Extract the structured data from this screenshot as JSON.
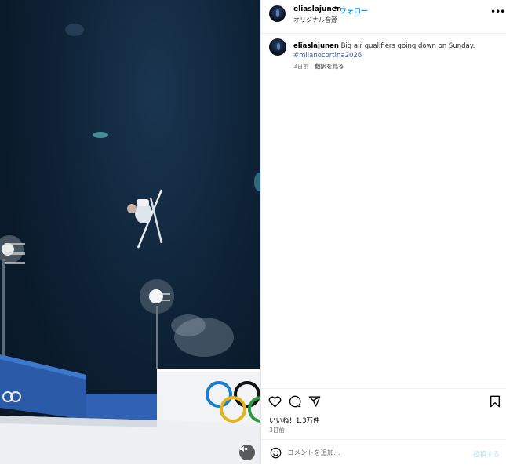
{
  "post": {
    "username": "eliaslajunen",
    "follow_label": "フォロー",
    "separator": "•",
    "audio_label": "オリジナル音源"
  },
  "caption": {
    "username": "eliaslajunen",
    "text": "Big air qualifiers going down on Sunday.",
    "hashtag": "#milanocortina2026",
    "time_ago": "3日前",
    "translate_label": "翻訳を見る"
  },
  "stats": {
    "likes": "いいね！1.3万件",
    "date": "3日前"
  },
  "comment": {
    "placeholder": "コメントを追加...",
    "post_label": "投稿する"
  },
  "icons": [
    "heart-icon",
    "comment-icon",
    "share-icon",
    "bookmark-icon",
    "more-icon",
    "emoji-icon",
    "mute-icon"
  ],
  "colors": {
    "accent": "#0095f6",
    "hashtag": "#385898",
    "post_disabled": "#b2dffc"
  }
}
